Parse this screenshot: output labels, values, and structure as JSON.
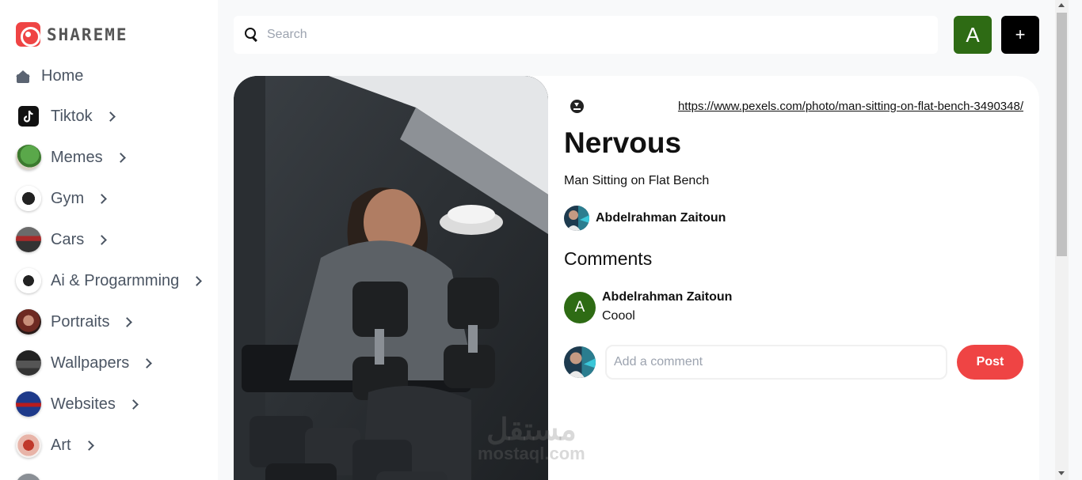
{
  "brand": {
    "logo_text": "SHAREME"
  },
  "sidebar": {
    "home_label": "Home",
    "categories": [
      {
        "label": "Tiktok",
        "icon": "tiktok-icon"
      },
      {
        "label": "Memes",
        "icon": "pepe-thumbnail"
      },
      {
        "label": "Gym",
        "icon": "gym-thumbnail"
      },
      {
        "label": "Cars",
        "icon": "car-thumbnail"
      },
      {
        "label": "Ai & Progarmming",
        "icon": "ai-thumbnail"
      },
      {
        "label": "Portraits",
        "icon": "portrait-thumbnail"
      },
      {
        "label": "Wallpapers",
        "icon": "wallpaper-thumbnail"
      },
      {
        "label": "Websites",
        "icon": "website-thumbnail"
      },
      {
        "label": "Art",
        "icon": "art-thumbnail"
      }
    ]
  },
  "topbar": {
    "search_placeholder": "Search",
    "avatar_letter": "A",
    "add_label": "+"
  },
  "pin": {
    "source_url": "https://www.pexels.com/photo/man-sitting-on-flat-bench-3490348/",
    "title": "Nervous",
    "description": "Man Sitting on Flat Bench",
    "author": "Abdelrahman Zaitoun",
    "comments_heading": "Comments",
    "comments": [
      {
        "avatar_letter": "A",
        "author": "Abdelrahman Zaitoun",
        "text": "Coool"
      }
    ],
    "comment_placeholder": "Add a comment",
    "post_label": "Post"
  },
  "watermark": {
    "arabic": "مستقل",
    "latin": "mostaql.com"
  },
  "colors": {
    "brand_red": "#ef4444",
    "avatar_green": "#2e6b14",
    "page_bg": "#f8f9fa"
  }
}
